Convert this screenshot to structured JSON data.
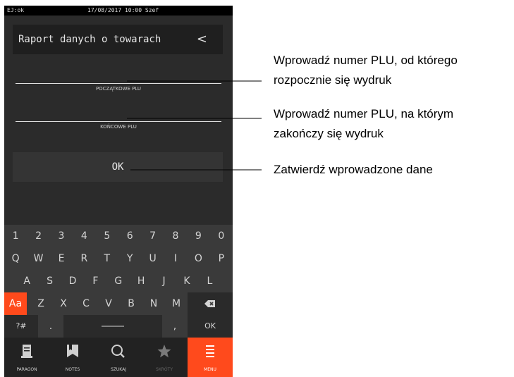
{
  "status_bar": {
    "left": "EJ:ok",
    "center": "17/08/2017 10:00 Szef"
  },
  "title_bar": {
    "title": "Raport danych o towarach",
    "back_glyph": "<"
  },
  "fields": [
    {
      "label": "POCZĄTKOWE PLU",
      "value": ""
    },
    {
      "label": "KOŃCOWE PLU",
      "value": ""
    }
  ],
  "ok_button": {
    "label": "OK"
  },
  "keyboard": {
    "row1": [
      "1",
      "2",
      "3",
      "4",
      "5",
      "6",
      "7",
      "8",
      "9",
      "0"
    ],
    "row2": [
      "Q",
      "W",
      "E",
      "R",
      "T",
      "Y",
      "U",
      "I",
      "O",
      "P"
    ],
    "row3": [
      "A",
      "S",
      "D",
      "F",
      "G",
      "H",
      "J",
      "K",
      "L"
    ],
    "row4": [
      "Z",
      "X",
      "C",
      "V",
      "B",
      "N",
      "M"
    ],
    "shift_label": "Aa",
    "symbols_label": "?#",
    "dot_label": ".",
    "comma_label": ",",
    "ok_label": "OK",
    "backspace_icon": "backspace-icon",
    "space_icon": "space-icon"
  },
  "nav": [
    {
      "label": "PARAGON",
      "icon": "receipt-icon",
      "state": "normal"
    },
    {
      "label": "NOTES",
      "icon": "bookmark-icon",
      "state": "normal"
    },
    {
      "label": "SZUKAJ",
      "icon": "search-icon",
      "state": "normal"
    },
    {
      "label": "SKRÓTY",
      "icon": "star-icon",
      "state": "disabled"
    },
    {
      "label": "MENU",
      "icon": "menu-icon",
      "state": "active"
    }
  ],
  "annotations": {
    "start_plu_line1": "Wprowadź numer PLU, od którego",
    "start_plu_line2": "rozpocznie się wydruk",
    "end_plu_line1": "Wprowadź numer PLU, na którym",
    "end_plu_line2": "zakończy się wydruk",
    "confirm": "Zatwierdź wprowadzone dane"
  },
  "colors": {
    "accent": "#ff4a1c",
    "background": "#2b2b2b",
    "keyboard": "#3a3a3a"
  }
}
